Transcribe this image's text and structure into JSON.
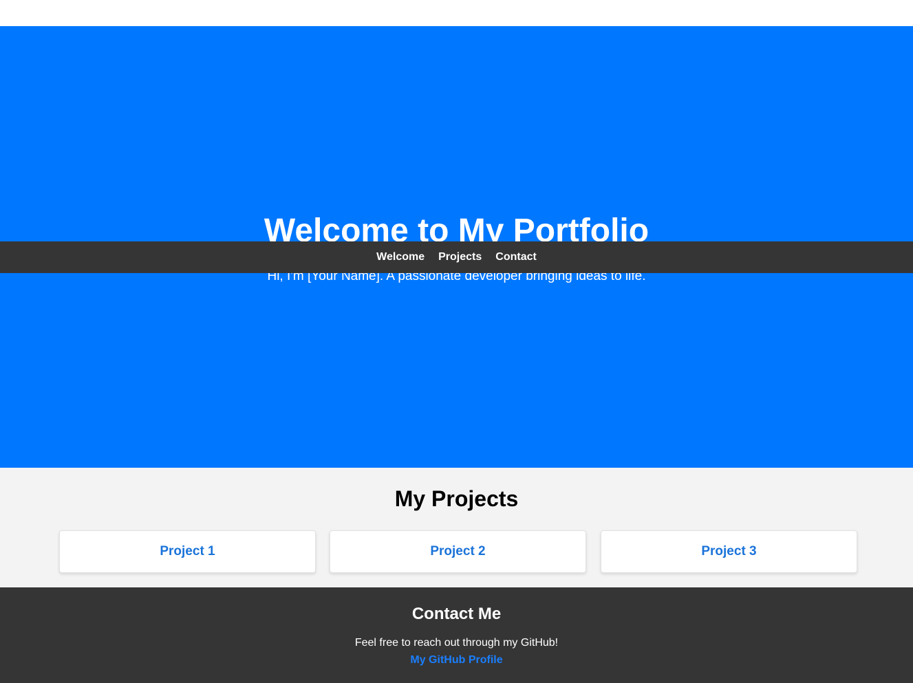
{
  "colors": {
    "hero_background": "#0077ff",
    "navbar_background": "#353535",
    "projects_background": "#f3f3f3",
    "footer_background": "#353535",
    "link_color": "#1a73d9",
    "footer_link_color": "#1a7fff"
  },
  "navbar": {
    "items": [
      {
        "label": "Welcome"
      },
      {
        "label": "Projects"
      },
      {
        "label": "Contact"
      }
    ]
  },
  "hero": {
    "title": "Welcome to My Portfolio",
    "subtitle": "Hi, I'm [Your Name]. A passionate developer bringing ideas to life."
  },
  "projects": {
    "title": "My Projects",
    "items": [
      {
        "label": "Project 1"
      },
      {
        "label": "Project 2"
      },
      {
        "label": "Project 3"
      }
    ]
  },
  "contact": {
    "title": "Contact Me",
    "text": "Feel free to reach out through my GitHub!",
    "link_label": "My GitHub Profile"
  }
}
